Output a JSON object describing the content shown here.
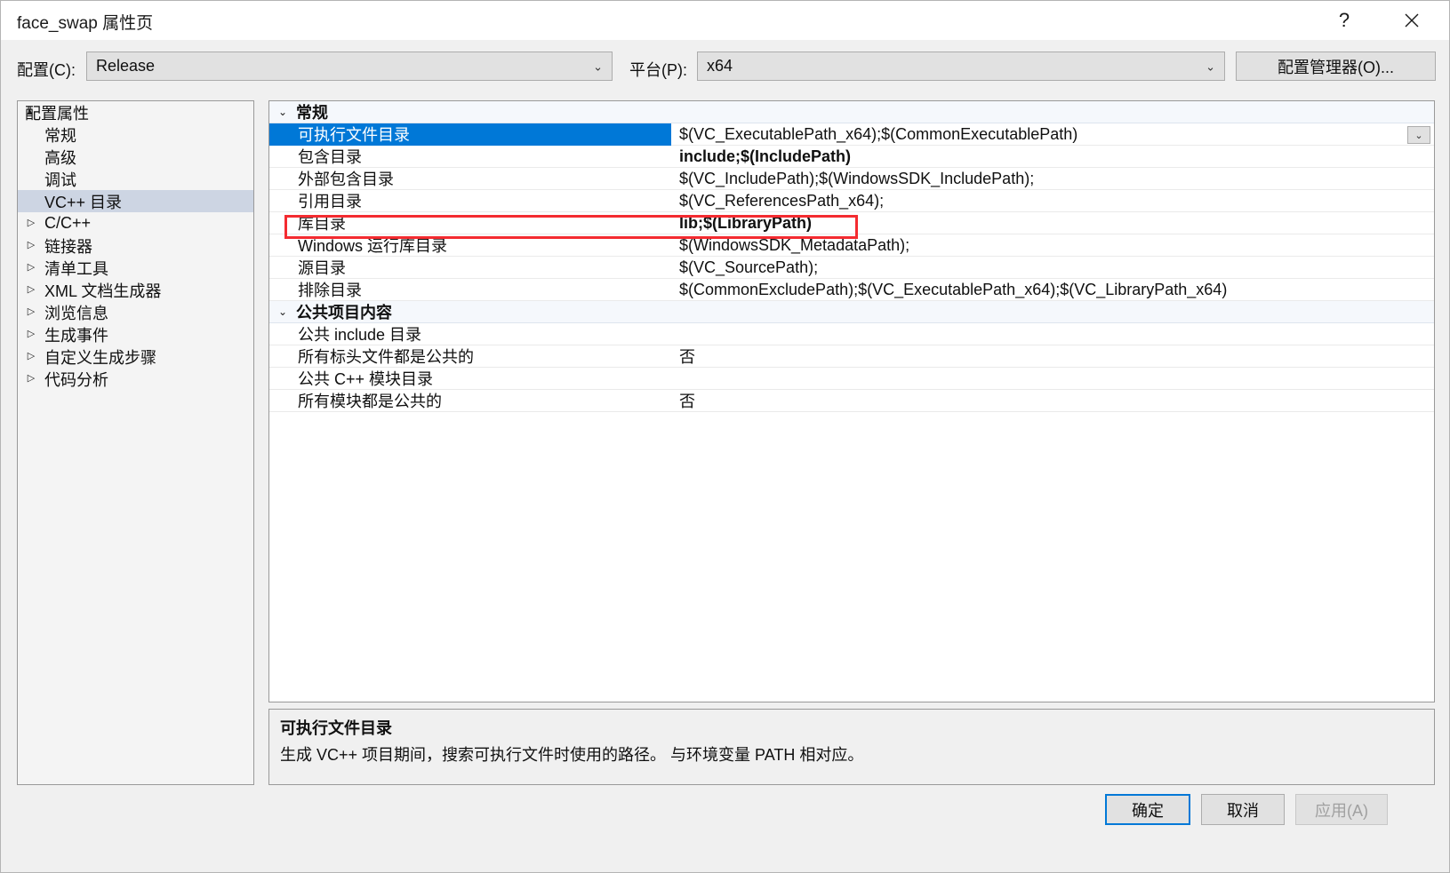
{
  "window": {
    "title": "face_swap 属性页",
    "help_icon": "question-mark-icon",
    "help_glyph": "?",
    "close_icon": "close-icon"
  },
  "toolbar": {
    "config_label": "配置(C):",
    "config_value": "Release",
    "platform_label": "平台(P):",
    "platform_value": "x64",
    "config_manager_label": "配置管理器(O)...",
    "chevron_glyph": "⌄"
  },
  "tree": {
    "items": [
      {
        "label": "配置属性",
        "level": "root",
        "expander": "▲",
        "selected": false
      },
      {
        "label": "常规",
        "level": "child",
        "expander": "",
        "selected": false
      },
      {
        "label": "高级",
        "level": "child",
        "expander": "",
        "selected": false
      },
      {
        "label": "调试",
        "level": "child",
        "expander": "",
        "selected": false
      },
      {
        "label": "VC++ 目录",
        "level": "child",
        "expander": "",
        "selected": true
      },
      {
        "label": "C/C++",
        "level": "expandable",
        "expander": "▷",
        "selected": false
      },
      {
        "label": "链接器",
        "level": "expandable",
        "expander": "▷",
        "selected": false
      },
      {
        "label": "清单工具",
        "level": "expandable",
        "expander": "▷",
        "selected": false
      },
      {
        "label": "XML 文档生成器",
        "level": "expandable",
        "expander": "▷",
        "selected": false
      },
      {
        "label": "浏览信息",
        "level": "expandable",
        "expander": "▷",
        "selected": false
      },
      {
        "label": "生成事件",
        "level": "expandable",
        "expander": "▷",
        "selected": false
      },
      {
        "label": "自定义生成步骤",
        "level": "expandable",
        "expander": "▷",
        "selected": false
      },
      {
        "label": "代码分析",
        "level": "expandable",
        "expander": "▷",
        "selected": false
      }
    ]
  },
  "grid": {
    "section_chevron": "⌄",
    "dropdown_glyph": "⌄",
    "rows": [
      {
        "kind": "section",
        "name": "常规",
        "value": "",
        "bold": false,
        "selected": false,
        "dropdown": false
      },
      {
        "kind": "prop",
        "name": "可执行文件目录",
        "value": "$(VC_ExecutablePath_x64);$(CommonExecutablePath)",
        "bold": false,
        "selected": true,
        "dropdown": true
      },
      {
        "kind": "prop",
        "name": "包含目录",
        "value": "include;$(IncludePath)",
        "bold": true,
        "selected": false,
        "dropdown": false
      },
      {
        "kind": "prop",
        "name": "外部包含目录",
        "value": "$(VC_IncludePath);$(WindowsSDK_IncludePath);",
        "bold": false,
        "selected": false,
        "dropdown": false
      },
      {
        "kind": "prop",
        "name": "引用目录",
        "value": "$(VC_ReferencesPath_x64);",
        "bold": false,
        "selected": false,
        "dropdown": false
      },
      {
        "kind": "prop",
        "name": "库目录",
        "value": "lib;$(LibraryPath)",
        "bold": true,
        "selected": false,
        "dropdown": false
      },
      {
        "kind": "prop",
        "name": "Windows 运行库目录",
        "value": "$(WindowsSDK_MetadataPath);",
        "bold": false,
        "selected": false,
        "dropdown": false
      },
      {
        "kind": "prop",
        "name": "源目录",
        "value": "$(VC_SourcePath);",
        "bold": false,
        "selected": false,
        "dropdown": false
      },
      {
        "kind": "prop",
        "name": "排除目录",
        "value": "$(CommonExcludePath);$(VC_ExecutablePath_x64);$(VC_LibraryPath_x64)",
        "bold": false,
        "selected": false,
        "dropdown": false
      },
      {
        "kind": "section",
        "name": "公共项目内容",
        "value": "",
        "bold": false,
        "selected": false,
        "dropdown": false
      },
      {
        "kind": "prop",
        "name": "公共 include 目录",
        "value": "",
        "bold": false,
        "selected": false,
        "dropdown": false
      },
      {
        "kind": "prop",
        "name": "所有标头文件都是公共的",
        "value": "否",
        "bold": false,
        "selected": false,
        "dropdown": false
      },
      {
        "kind": "prop",
        "name": "公共 C++ 模块目录",
        "value": "",
        "bold": false,
        "selected": false,
        "dropdown": false
      },
      {
        "kind": "prop",
        "name": "所有模块都是公共的",
        "value": "否",
        "bold": false,
        "selected": false,
        "dropdown": false
      }
    ]
  },
  "annotation": {
    "color": "#f42b30",
    "target_row": "库目录"
  },
  "description": {
    "title": "可执行文件目录",
    "body": "生成 VC++ 项目期间，搜索可执行文件时使用的路径。 与环境变量 PATH 相对应。"
  },
  "footer": {
    "ok_label": "确定",
    "cancel_label": "取消",
    "apply_label": "应用(A)"
  }
}
